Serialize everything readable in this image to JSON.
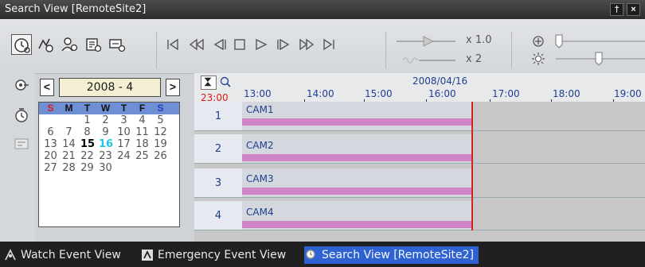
{
  "window": {
    "title": "Search View [RemoteSite2]",
    "pin_label": "†",
    "close_label": "×"
  },
  "toolbar": {
    "mode_icons": [
      "time-search-icon",
      "event-search-icon",
      "person-search-icon",
      "text-search-icon",
      "motion-search-icon"
    ],
    "playback_icons": [
      "go-to-first-icon",
      "fast-rewind-icon",
      "step-back-icon",
      "stop-icon",
      "play-icon",
      "step-forward-icon",
      "fast-forward-icon",
      "go-to-last-icon"
    ],
    "speed_play": "x 1.0",
    "speed_audio": "x 2",
    "zoom_icon": "zoom-plus-icon",
    "brightness_icon": "brightness-icon"
  },
  "calendar": {
    "prev": "<",
    "next": ">",
    "month_label": "2008 - 4",
    "weekdays": [
      "S",
      "M",
      "T",
      "W",
      "T",
      "F",
      "S"
    ],
    "weeks": [
      [
        "",
        "",
        "1",
        "2",
        "3",
        "4",
        "5"
      ],
      [
        "6",
        "7",
        "8",
        "9",
        "10",
        "11",
        "12"
      ],
      [
        "13",
        "14",
        "15",
        "16",
        "17",
        "18",
        "19"
      ],
      [
        "20",
        "21",
        "22",
        "23",
        "24",
        "25",
        "26"
      ],
      [
        "27",
        "28",
        "29",
        "30",
        "",
        "",
        ""
      ]
    ],
    "today": "15",
    "selected": "16",
    "header_color": "#6f8fd5",
    "sunday_color": "#e01818",
    "saturday_color": "#1f3fbf",
    "selected_color": "#22c7e6"
  },
  "timeline": {
    "current_time": "23:00",
    "date": "2008/04/16",
    "hours": [
      "13:00",
      "14:00",
      "15:00",
      "16:00",
      "17:00",
      "18:00",
      "19:00"
    ],
    "channels": [
      {
        "num": "1",
        "name": "CAM1"
      },
      {
        "num": "2",
        "name": "CAM2"
      },
      {
        "num": "3",
        "name": "CAM3"
      },
      {
        "num": "4",
        "name": "CAM4"
      }
    ],
    "bar_color": "#cf85c6",
    "now_color": "#d82020"
  },
  "tabs": [
    {
      "label": "Watch Event View",
      "icon": "watch-event-icon",
      "active": false
    },
    {
      "label": "Emergency Event View",
      "icon": "emergency-event-icon",
      "active": false
    },
    {
      "label": "Search View [RemoteSite2]",
      "icon": "search-view-icon",
      "active": true
    }
  ]
}
